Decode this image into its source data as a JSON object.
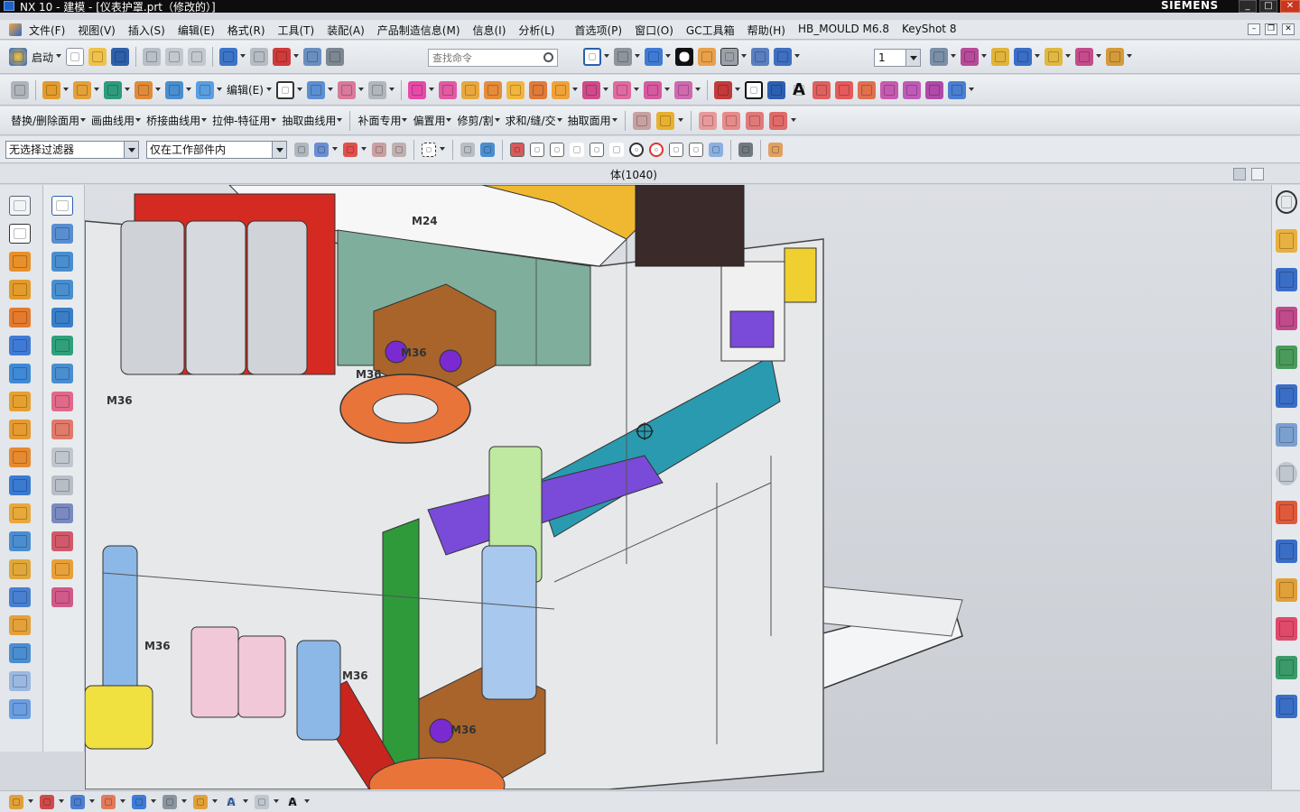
{
  "window": {
    "title": "NX 10 - 建模 - [仪表护罩.prt（修改的）]",
    "brand": "SIEMENS"
  },
  "menu": {
    "items": [
      "文件(F)",
      "视图(V)",
      "插入(S)",
      "编辑(E)",
      "格式(R)",
      "工具(T)",
      "装配(A)",
      "产品制造信息(M)",
      "信息(I)",
      "分析(L)",
      "首选项(P)",
      "窗口(O)",
      "GC工具箱",
      "帮助(H)",
      "HB_MOULD M6.8",
      "KeyShot 8"
    ]
  },
  "toolbar1": {
    "start_label": "启动",
    "search_placeholder": "查找命令",
    "layer_value": "1"
  },
  "toolbar2": {
    "edit_label": "编辑(E)"
  },
  "toolbar3": {
    "items": [
      "替换/删除面用",
      "画曲线用",
      "桥接曲线用",
      "拉伸-特征用",
      "抽取曲线用",
      "补面专用",
      "偏置用",
      "修剪/割",
      "求和/缝/交",
      "抽取面用"
    ]
  },
  "selection": {
    "filter_value": "无选择过滤器",
    "scope_value": "仅在工作部件内"
  },
  "viewport": {
    "label": "体(1040)",
    "part_labels": [
      "M24",
      "M36",
      "M36",
      "M36",
      "M36",
      "M36",
      "M36"
    ]
  },
  "colors": {
    "accent_orange": "#e07a3a",
    "model_green": "#2e9a3a",
    "model_red": "#c8251f",
    "model_blue": "#4a8ed0"
  }
}
